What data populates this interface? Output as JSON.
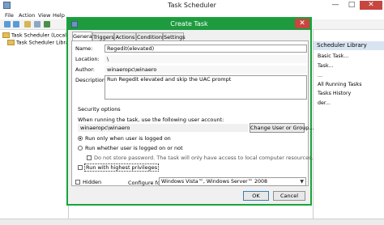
{
  "main_window": {
    "title": "Task Scheduler",
    "menu": [
      "File",
      "Action",
      "View",
      "Help"
    ],
    "tree": [
      {
        "label": "Task Scheduler (Local)"
      },
      {
        "label": "Task Scheduler Library"
      }
    ],
    "actions_header": "Scheduler Library",
    "actions": [
      "Basic Task...",
      "Task...",
      "...",
      "All Running Tasks",
      "Tasks History",
      "der..."
    ],
    "window_buttons": {
      "minimize": "—",
      "maximize": "□",
      "close": "✕"
    }
  },
  "dialog": {
    "title": "Create Task",
    "close_glyph": "✕",
    "tabs": [
      "General",
      "Triggers",
      "Actions",
      "Conditions",
      "Settings"
    ],
    "active_tab": "General",
    "fields": {
      "name_label": "Name:",
      "name_value": "Regedit(elevated)",
      "location_label": "Location:",
      "location_value": "\\",
      "author_label": "Author:",
      "author_value": "winaeropc\\winaero",
      "description_label": "Description:",
      "description_value": "Run Regedit elevated and skip the UAC prompt"
    },
    "security": {
      "section_label": "Security options",
      "account_prompt": "When running the task, use the following user account:",
      "account_value": "winaeropc\\winaero",
      "change_button": "Change User or Group...",
      "radio_logged_on": "Run only when user is logged on",
      "radio_whether": "Run whether user is logged on or not",
      "no_store_password": "Do not store password.  The task will only have access to local computer resources.",
      "highest_privileges": "Run with highest privileges"
    },
    "hidden_label": "Hidden",
    "configure_label": "Configure for:",
    "configure_value": "Windows Vista™, Windows Server™ 2008",
    "ok_button": "OK",
    "cancel_button": "Cancel",
    "selected_radio": "logged_on",
    "highest_privileges_checked": false,
    "hidden_checked": false,
    "accent_color": "#1e9a3f"
  }
}
